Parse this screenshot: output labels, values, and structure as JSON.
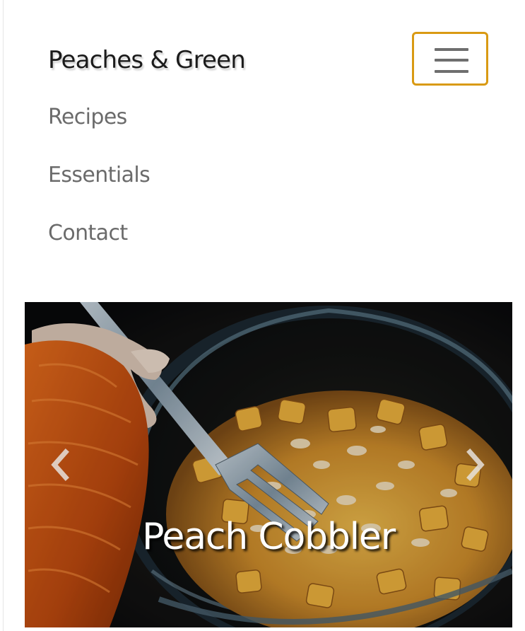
{
  "navbar": {
    "brand": "Peaches & Green",
    "toggler_icon": "hamburger-menu-icon",
    "toggler_border_color": "#d99a13",
    "links": [
      {
        "label": "Recipes"
      },
      {
        "label": "Essentials"
      },
      {
        "label": "Contact"
      }
    ]
  },
  "carousel": {
    "active_slide": {
      "caption": "Peach Cobbler",
      "image_alt": "Bowl of peach cobbler with oats and a fork"
    },
    "prev_icon": "chevron-left-icon",
    "next_icon": "chevron-right-icon"
  }
}
